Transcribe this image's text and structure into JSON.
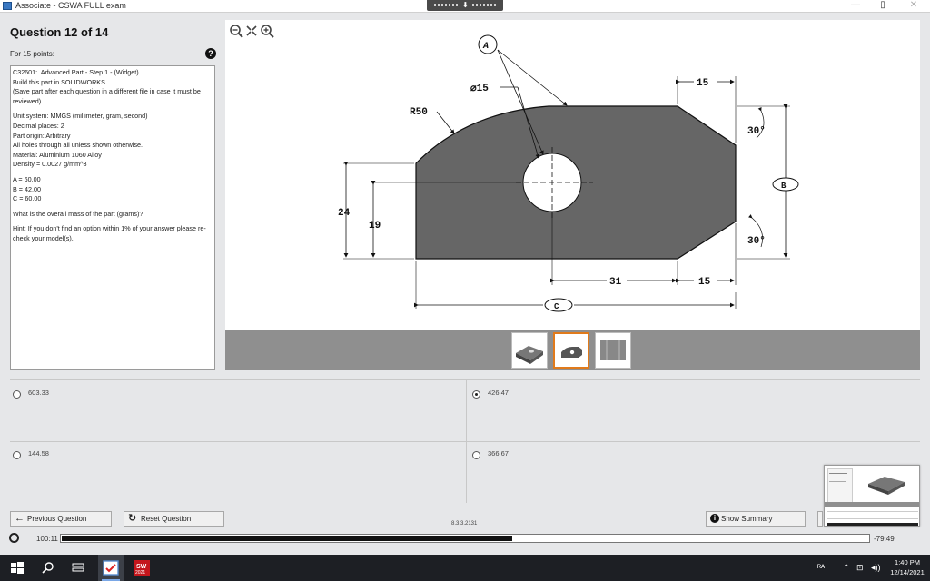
{
  "window": {
    "title": "Associate - CSWA FULL exam",
    "minimize_glyph": "—",
    "maximize_glyph": "▯",
    "close_glyph": "✕"
  },
  "question": {
    "title": "Question 12 of 14",
    "points": "For 15 points:",
    "help_glyph": "?",
    "body": [
      "C32601:  Advanced Part - Step 1 - (Widget)",
      "Build this part in SOLIDWORKS.",
      "(Save part after each question in a different file in case it must be reviewed)",
      "",
      "Unit system: MMGS (millimeter, gram, second)",
      "Decimal places: 2",
      "Part origin: Arbitrary",
      "All holes through all unless shown otherwise.",
      "Material: Aluminium 1060 Alloy",
      "Density = 0.0027 g/mm^3",
      "",
      "A = 60.00",
      "B = 42.00",
      "C = 60.00",
      "",
      "What is the overall mass of the part (grams)?",
      "",
      "Hint: If you don't find an option within 1% of your answer please re-check your model(s)."
    ]
  },
  "drawing": {
    "dim_r50": "R50",
    "dim_dia15": "⌀15",
    "dim_top15": "15",
    "dim_30_top": "30°",
    "dim_30_bottom": "30°",
    "dim_24": "24",
    "dim_19": "19",
    "dim_31": "31",
    "dim_bottom15": "15",
    "balloon_b": "B",
    "balloon_c": "C",
    "balloon_a": "A",
    "fill_color": "#666666"
  },
  "answers": [
    {
      "label": "603.33",
      "selected": false
    },
    {
      "label": "426.47",
      "selected": true
    },
    {
      "label": "144.58",
      "selected": false
    },
    {
      "label": "366.67",
      "selected": false
    }
  ],
  "nav": {
    "previous": "Previous Question",
    "reset": "Reset Question",
    "summary": "Show Summary",
    "version": "8.3.3.2131"
  },
  "timer": {
    "elapsed": "100:11",
    "remaining": "-79:49",
    "progress_fraction": 0.558
  },
  "taskbar": {
    "time": "1:40 PM",
    "date": "12/14/2021",
    "sw_badge": "2021"
  }
}
